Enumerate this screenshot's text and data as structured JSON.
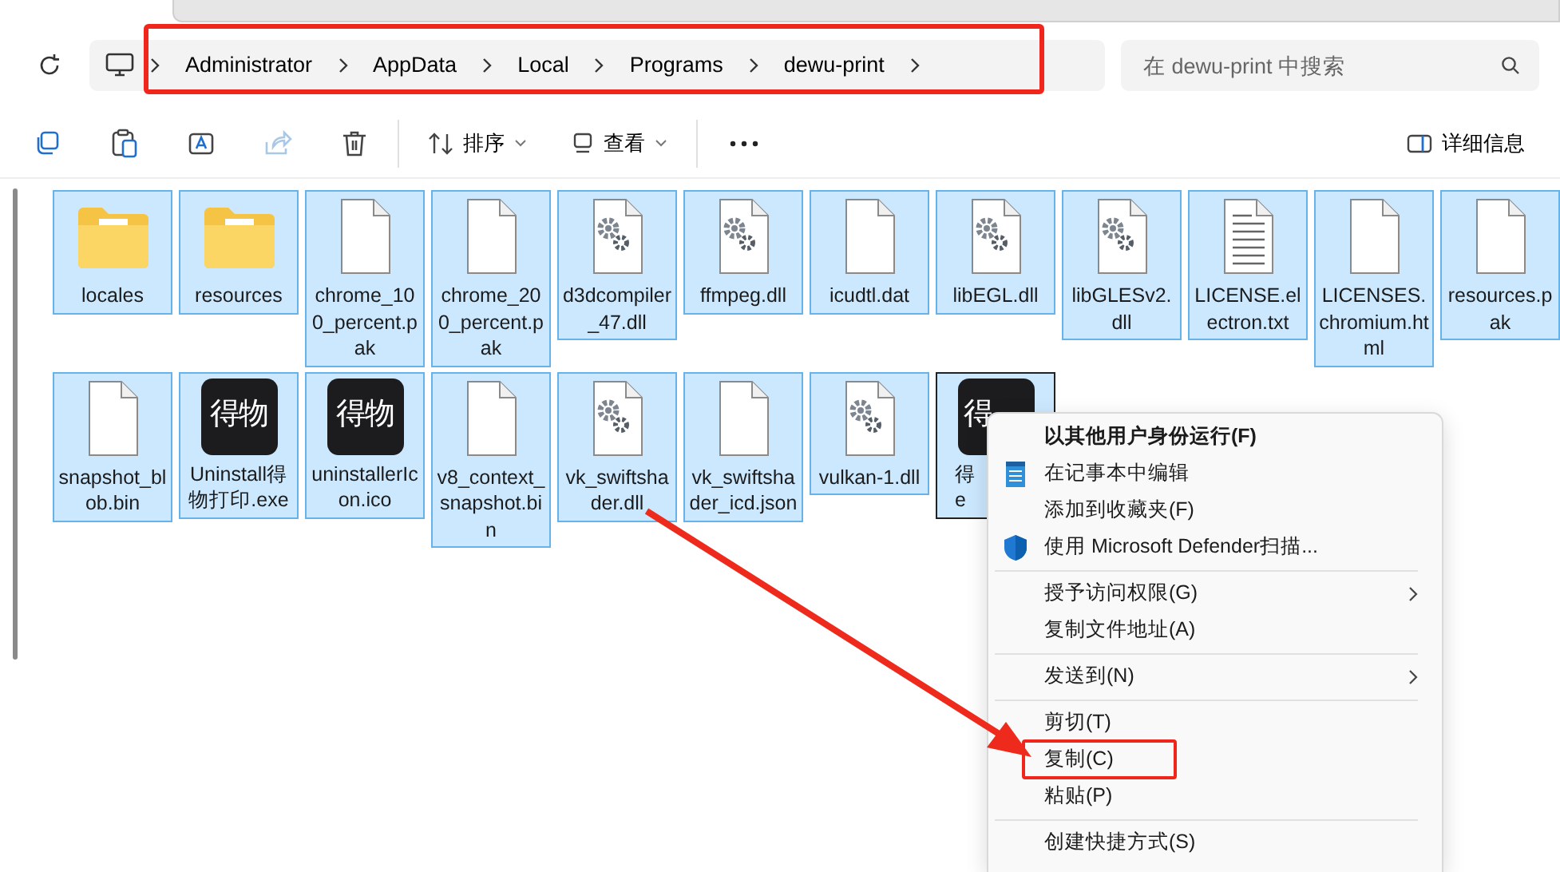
{
  "address": {
    "highlighted": true,
    "segments": [
      "Administrator",
      "AppData",
      "Local",
      "Programs",
      "dewu-print"
    ]
  },
  "search": {
    "placeholder": "在 dewu-print 中搜索"
  },
  "toolbar": {
    "items": [
      {
        "kind": "copy",
        "disabled": false
      },
      {
        "kind": "paste",
        "disabled": false
      },
      {
        "kind": "rename",
        "disabled": false
      },
      {
        "kind": "share",
        "disabled": true
      },
      {
        "kind": "delete",
        "disabled": false
      },
      {
        "kind": "divider"
      },
      {
        "kind": "sort",
        "label": "排序"
      },
      {
        "kind": "view",
        "label": "查看"
      },
      {
        "kind": "divider"
      },
      {
        "kind": "more"
      }
    ],
    "details": "详细信息"
  },
  "files": [
    {
      "kind": "folder",
      "label": "locales",
      "selected": true,
      "focused": false
    },
    {
      "kind": "folder",
      "label": "resources",
      "selected": true,
      "focused": false
    },
    {
      "kind": "file",
      "label": "chrome_100_percent.pak",
      "selected": true,
      "focused": false
    },
    {
      "kind": "file",
      "label": "chrome_200_percent.pak",
      "selected": true,
      "focused": false
    },
    {
      "kind": "gear",
      "label": "d3dcompiler_47.dll",
      "selected": true,
      "focused": false
    },
    {
      "kind": "gear",
      "label": "ffmpeg.dll",
      "selected": true,
      "focused": false
    },
    {
      "kind": "file",
      "label": "icudtl.dat",
      "selected": true,
      "focused": false
    },
    {
      "kind": "gear",
      "label": "libEGL.dll",
      "selected": true,
      "focused": false
    },
    {
      "kind": "gear",
      "label": "libGLESv2.dll",
      "selected": true,
      "focused": false
    },
    {
      "kind": "text",
      "label": "LICENSE.electron.txt",
      "selected": true,
      "focused": false
    },
    {
      "kind": "file",
      "label": "LICENSES.chromium.html",
      "selected": true,
      "focused": false
    },
    {
      "kind": "file",
      "label": "resources.pak",
      "selected": true,
      "focused": false
    },
    {
      "kind": "file",
      "label": "snapshot_blob.bin",
      "selected": true,
      "focused": false
    },
    {
      "kind": "app",
      "icon_text": "得物",
      "label": "Uninstall得物打印.exe",
      "selected": true,
      "focused": false
    },
    {
      "kind": "app",
      "icon_text": "得物",
      "label": "uninstallerIcon.ico",
      "selected": true,
      "focused": false
    },
    {
      "kind": "file",
      "label": "v8_context_snapshot.bin",
      "selected": true,
      "focused": false
    },
    {
      "kind": "gear",
      "label": "vk_swiftshader.dll",
      "selected": true,
      "focused": false
    },
    {
      "kind": "file",
      "label": "vk_swiftshader_icd.json",
      "selected": true,
      "focused": false
    },
    {
      "kind": "gear",
      "label": "vulkan-1.dll",
      "selected": true,
      "focused": false
    },
    {
      "kind": "app",
      "icon_text": "得",
      "label": "得\ne",
      "selected": true,
      "focused": true
    }
  ],
  "context_menu": {
    "items": [
      {
        "kind": "plain",
        "label": "以其他用户身份运行(F)",
        "bold": true,
        "submenu": false,
        "highlighted": false
      },
      {
        "kind": "editor",
        "label": "在记事本中编辑",
        "bold": false,
        "submenu": false,
        "highlighted": false
      },
      {
        "kind": "plain",
        "label": "添加到收藏夹(F)",
        "bold": false,
        "submenu": false,
        "highlighted": false
      },
      {
        "kind": "scan",
        "label": "使用 Microsoft Defender扫描...",
        "bold": false,
        "submenu": false,
        "highlighted": false
      },
      {
        "kind": "separator"
      },
      {
        "kind": "plain",
        "label": "授予访问权限(G)",
        "bold": false,
        "submenu": true,
        "highlighted": false
      },
      {
        "kind": "plain",
        "label": "复制文件地址(A)",
        "bold": false,
        "submenu": false,
        "highlighted": false
      },
      {
        "kind": "separator"
      },
      {
        "kind": "plain",
        "label": "发送到(N)",
        "bold": false,
        "submenu": true,
        "highlighted": false
      },
      {
        "kind": "separator"
      },
      {
        "kind": "plain",
        "label": "剪切(T)",
        "bold": false,
        "submenu": false,
        "highlighted": false
      },
      {
        "kind": "plain",
        "label": "复制(C)",
        "bold": false,
        "submenu": false,
        "highlighted": true
      },
      {
        "kind": "plain",
        "label": "粘贴(P)",
        "bold": false,
        "submenu": false,
        "highlighted": false
      },
      {
        "kind": "separator"
      },
      {
        "kind": "plain",
        "label": "创建快捷方式(S)",
        "bold": false,
        "submenu": false,
        "highlighted": false
      }
    ]
  }
}
